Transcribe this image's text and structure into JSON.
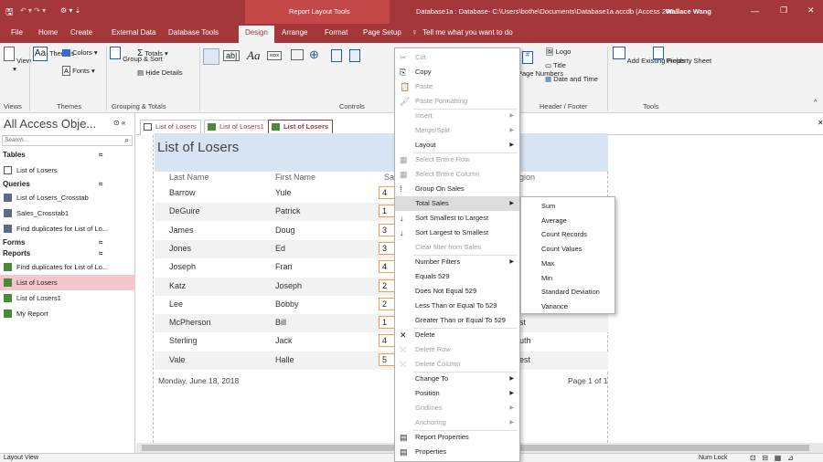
{
  "titlebar": {
    "qat_save": "🖫",
    "context_label": "Report Layout Tools",
    "doc_title": "Database1a : Database- C:\\Users\\bothe\\Documents\\Database1a.accdb (Access 200...",
    "user": "Wallace Wang",
    "min": "—",
    "restore": "❐",
    "close": "✕"
  },
  "tabs": [
    "File",
    "Home",
    "Create",
    "External Data",
    "Database Tools",
    "Design",
    "Arrange",
    "Format",
    "Page Setup"
  ],
  "active_tab": "Design",
  "tell_me": "Tell me what you want to do",
  "ribbon": {
    "view": "View",
    "themes": "Themes",
    "colors": "Colors",
    "fonts": "Fonts",
    "group_sort": "Group & Sort",
    "totals": "Totals",
    "hide_details": "Hide Details",
    "logo": "Logo",
    "title": "Title",
    "page_numbers": "Page Numbers",
    "date_time": "Date and Time",
    "add_existing_fields": "Add Existing Fields",
    "property_sheet": "Property Sheet",
    "groups": {
      "views": "Views",
      "themes": "Themes",
      "grouping": "Grouping & Totals",
      "controls": "Controls",
      "header_footer": "Header / Footer",
      "tools": "Tools"
    }
  },
  "nav": {
    "title": "All Access Obje...",
    "search": "Search...",
    "sections": [
      {
        "label": "Tables",
        "items": [
          "List of Losers"
        ]
      },
      {
        "label": "Queries",
        "items": [
          "List of Losers_Crosstab",
          "Sales_Crosstab1",
          "Find duplicates for List of Lo..."
        ]
      },
      {
        "label": "Forms",
        "items": []
      },
      {
        "label": "Reports",
        "items": [
          "Find duplicates for List of Lo...",
          "List of Losers",
          "List of Losers1",
          "My Report"
        ]
      }
    ]
  },
  "doc_tabs": [
    "List of Losers",
    "List of Losers1",
    "List of Losers"
  ],
  "report": {
    "title": "List of Losers",
    "headers": {
      "last": "Last Name",
      "first": "First Name",
      "sales": "Sal",
      "region": "gion"
    },
    "rows": [
      {
        "last": "Barrow",
        "first": "Yule",
        "sales": "4",
        "region": ""
      },
      {
        "last": "DeGuire",
        "first": "Patrick",
        "sales": "1",
        "region": ""
      },
      {
        "last": "James",
        "first": "Doug",
        "sales": "3",
        "region": ""
      },
      {
        "last": "Jones",
        "first": "Ed",
        "sales": "3",
        "region": ""
      },
      {
        "last": "Joseph",
        "first": "Fran",
        "sales": "4",
        "region": ""
      },
      {
        "last": "Katz",
        "first": "Joseph",
        "sales": "2",
        "region": ""
      },
      {
        "last": "Lee",
        "first": "Bobby",
        "sales": "2",
        "region": ""
      },
      {
        "last": "McPherson",
        "first": "Bill",
        "sales": "1",
        "region": "st"
      },
      {
        "last": "Sterling",
        "first": "Jack",
        "sales": "4",
        "region": "uth"
      },
      {
        "last": "Vale",
        "first": "Halle",
        "sales": "5",
        "region": "est"
      }
    ],
    "date": "Monday, June 18, 2018",
    "page": "Page 1 of 1"
  },
  "context_menu": [
    {
      "label": "Cut",
      "icon": "✂",
      "disabled": true
    },
    {
      "label": "Copy",
      "icon": "⎘"
    },
    {
      "label": "Paste",
      "icon": "📋",
      "disabled": true
    },
    {
      "label": "Paste Formatting",
      "icon": "🖌",
      "disabled": true
    },
    {
      "label": "Insert",
      "disabled": true,
      "sub": true
    },
    {
      "label": "Merge/Split",
      "disabled": true,
      "sub": true
    },
    {
      "label": "Layout",
      "sub": true
    },
    {
      "label": "Select Entire Row",
      "icon": "▦",
      "disabled": true
    },
    {
      "label": "Select Entire Column",
      "icon": "▦",
      "disabled": true
    },
    {
      "label": "Group On Sales",
      "icon": "⁞"
    },
    {
      "label": "Total Sales",
      "sub": true,
      "highlight": true
    },
    {
      "label": "Sort Smallest to Largest",
      "icon": "↓"
    },
    {
      "label": "Sort Largest to Smallest",
      "icon": "↓"
    },
    {
      "label": "Clear filter from Sales",
      "disabled": true
    },
    {
      "label": "Number Filters",
      "sub": true
    },
    {
      "label": "Equals 529"
    },
    {
      "label": "Does Not Equal 529"
    },
    {
      "label": "Less Than or Equal To 529"
    },
    {
      "label": "Greater Than or Equal To 529"
    },
    {
      "label": "Delete",
      "icon": "✕"
    },
    {
      "label": "Delete Row",
      "icon": "⤫",
      "disabled": true
    },
    {
      "label": "Delete Column",
      "icon": "⤫",
      "disabled": true
    },
    {
      "label": "Change To",
      "sub": true
    },
    {
      "label": "Position",
      "sub": true
    },
    {
      "label": "Gridlines",
      "disabled": true,
      "sub": true
    },
    {
      "label": "Anchoring",
      "disabled": true,
      "sub": true
    },
    {
      "label": "Report Properties",
      "icon": "▤"
    },
    {
      "label": "Properties",
      "icon": "▤"
    }
  ],
  "submenu": [
    "Sum",
    "Average",
    "Count Records",
    "Count Values",
    "Max",
    "Min",
    "Standard Deviation",
    "Variance"
  ],
  "status": {
    "left": "Layout View",
    "numlock": "Num Lock"
  },
  "colors": {
    "accent": "#a4373a",
    "header_band": "#d6e4f4",
    "sales_border": "#f0a050",
    "highlight_nav": "#f3c7cc"
  }
}
